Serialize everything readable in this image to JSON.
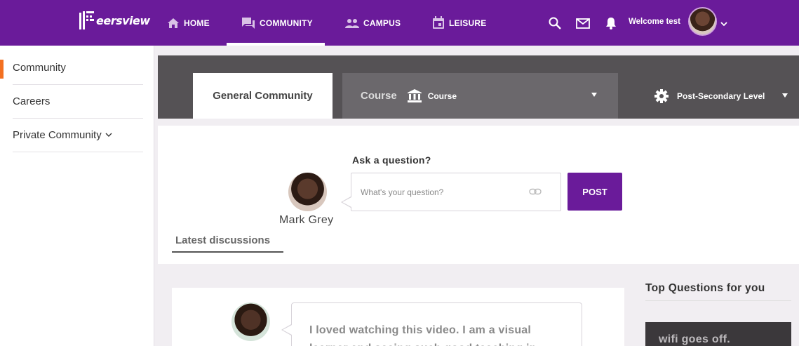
{
  "brand": {
    "name": "eersview",
    "colors": {
      "primary": "#6a1b9a",
      "accent": "#f37021",
      "header_band": "#555255"
    }
  },
  "nav": {
    "items": [
      {
        "label": "HOME",
        "icon": "home-icon"
      },
      {
        "label": "COMMUNITY",
        "icon": "chat-icon",
        "active": true
      },
      {
        "label": "CAMPUS",
        "icon": "people-icon"
      },
      {
        "label": "LEISURE",
        "icon": "calendar-icon"
      }
    ],
    "icons": [
      "search-icon",
      "mail-icon",
      "bell-icon"
    ],
    "welcome": "Welcome test"
  },
  "sidebar": {
    "items": [
      {
        "label": "Community",
        "active": true
      },
      {
        "label": "Careers"
      },
      {
        "label": "Private Community"
      }
    ]
  },
  "tabs": {
    "general": "General Community",
    "course_label": "Course",
    "course_selected": "Course",
    "level": "Post-Secondary Level"
  },
  "ask": {
    "label": "Ask a question?",
    "user_name": "Mark Grey",
    "placeholder": "What's your question?",
    "post_label": "POST"
  },
  "latest": {
    "label": "Latest discussions"
  },
  "discussion": {
    "text": "I loved watching this video. I am a visual learner and seeing such good teaching in"
  },
  "top_questions": {
    "title": "Top Questions for you",
    "first": "wifi goes off."
  }
}
